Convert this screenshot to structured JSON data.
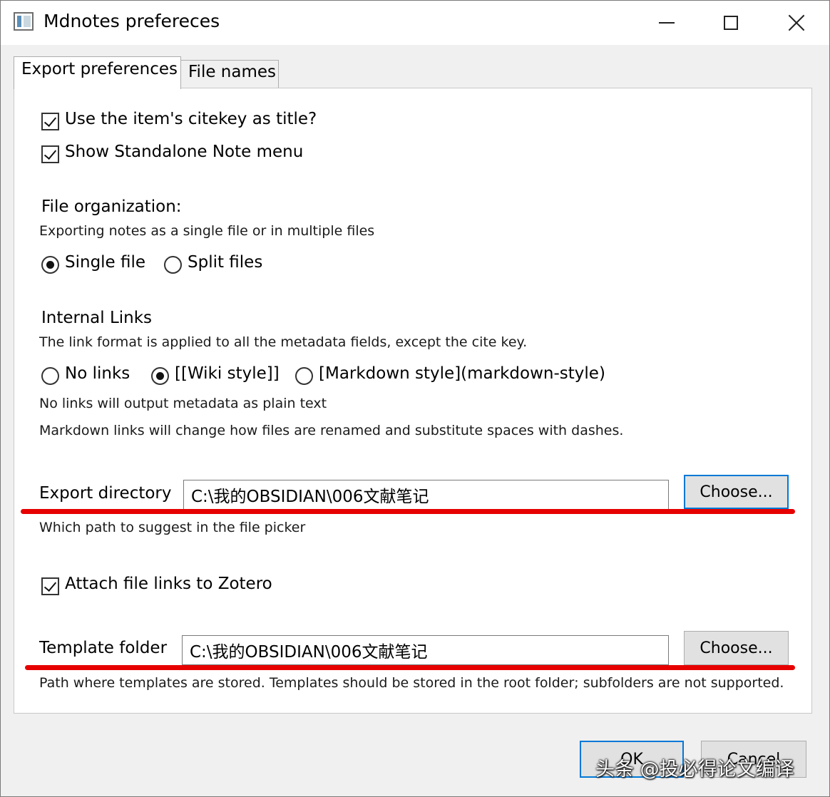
{
  "window": {
    "title": "Mdnotes prefereces"
  },
  "tabs": [
    {
      "label": "Export preferences",
      "active": true
    },
    {
      "label": "File names",
      "active": false
    }
  ],
  "options": {
    "citekey_title": {
      "label": "Use the item's citekey as title?",
      "checked": true
    },
    "standalone_menu": {
      "label": "Show Standalone Note menu",
      "checked": true
    }
  },
  "file_organization": {
    "heading": "File organization:",
    "description": "Exporting notes as a single file or in multiple files",
    "choices": [
      {
        "label": "Single file",
        "selected": true
      },
      {
        "label": "Split files",
        "selected": false
      }
    ]
  },
  "internal_links": {
    "heading": "Internal Links",
    "description": "The link format is applied to all the metadata fields, except the cite key.",
    "choices": [
      {
        "label": "No links",
        "selected": false
      },
      {
        "label": "[[Wiki style]]",
        "selected": true
      },
      {
        "label": "[Markdown style](markdown-style)",
        "selected": false
      }
    ],
    "note1": "No links will output metadata as plain text",
    "note2": "Markdown links will change how files are renamed and substitute spaces with dashes."
  },
  "export_directory": {
    "label": "Export directory",
    "value": "C:\\我的OBSIDIAN\\006文献笔记",
    "button": "Choose...",
    "hint": "Which path to suggest in the file picker"
  },
  "attach_links": {
    "label": "Attach file links to Zotero",
    "checked": true
  },
  "template_folder": {
    "label": "Template folder",
    "value": "C:\\我的OBSIDIAN\\006文献笔记",
    "button": "Choose...",
    "hint": "Path where templates are stored. Templates should be stored in the root folder; subfolders are not supported."
  },
  "footer": {
    "ok": "OK",
    "cancel": "Cancel"
  },
  "watermark": "头条 @投必得论文编译",
  "colors": {
    "annotation_red": "#e60000",
    "focus_blue": "#0078d7"
  }
}
